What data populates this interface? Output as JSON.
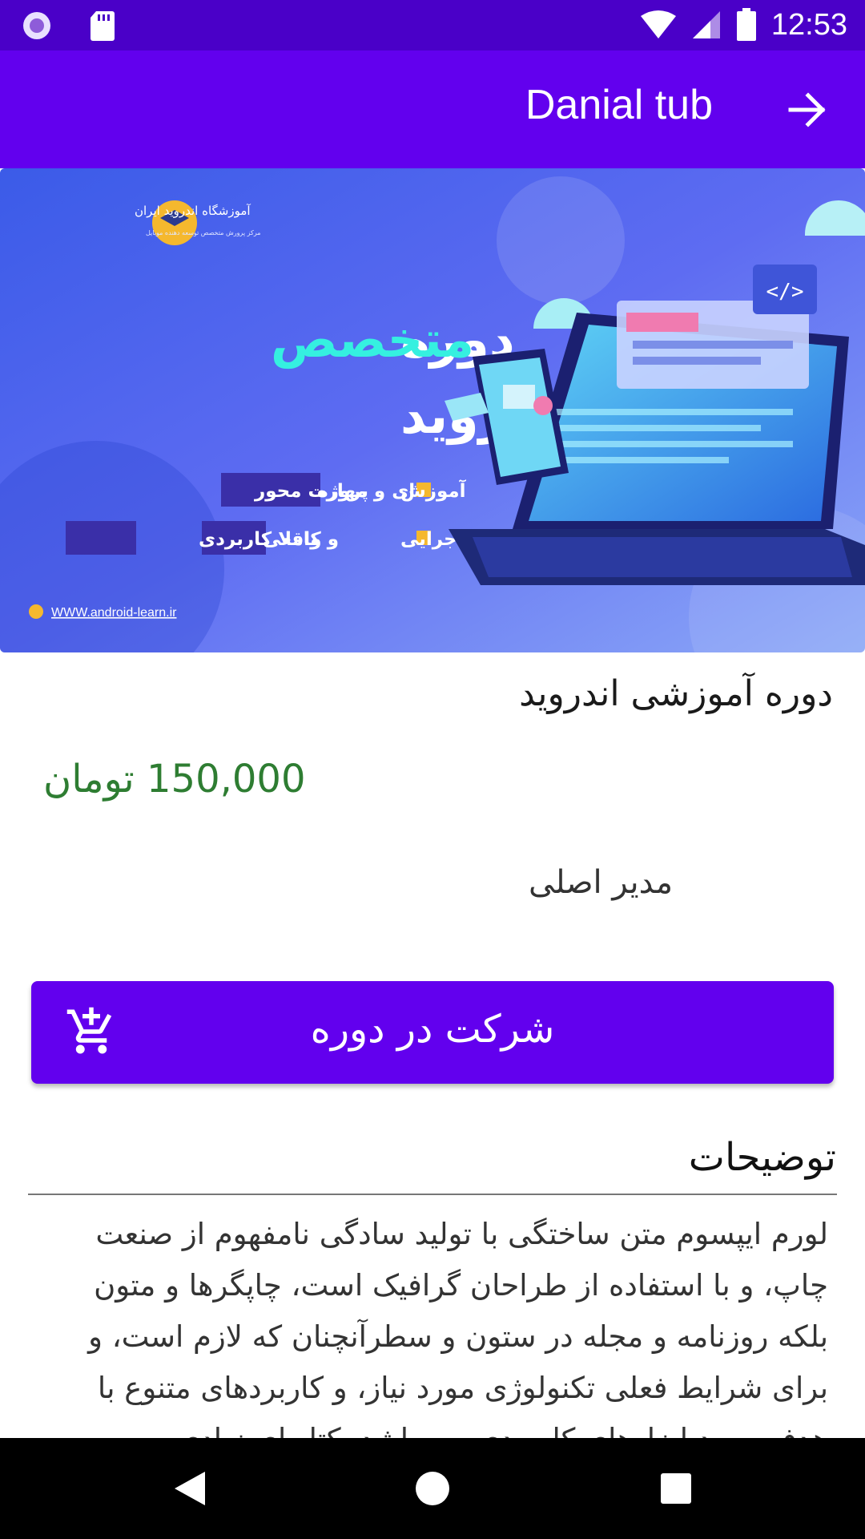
{
  "status_bar": {
    "time": "12:53",
    "icons": [
      "notification-circle-icon",
      "sd-card-icon",
      "wifi-icon",
      "signal-icon",
      "battery-icon"
    ]
  },
  "app_bar": {
    "title": "Danial tub",
    "back_icon": "arrow-right-icon"
  },
  "banner": {
    "brand_name": "آموزشگاه اندروید ایران",
    "brand_tagline": "مرکز پرورش متخصص توسعه دهنده موبایل",
    "headline_word1": "دوره",
    "headline_word2": "متخصص",
    "headline_line2": "اندروید",
    "bullet1_a": "آموزش",
    "bullet1_b": "پروژه",
    "bullet1_c": "ای و مهارت محور",
    "bullet2_a": "۶ پروژه اجرایی",
    "bullet2_b": "واقعی",
    "bullet2_c": "و کاملا کاربردی",
    "website": "WWW.android-learn.ir",
    "code_tag": "</>"
  },
  "course": {
    "title": "دوره آموزشی اندروید",
    "price": "150,000 تومان",
    "teacher": "مدیر اصلی"
  },
  "enroll": {
    "label": "شرکت در دوره",
    "icon": "add-shopping-cart-icon"
  },
  "description": {
    "heading": "توضیحات",
    "body": "لورم ایپسوم متن ساختگی با تولید سادگی نامفهوم از صنعت چاپ، و با استفاده از طراحان گرافیک است، چاپگرها و متون بلکه روزنامه و مجله در ستون و سطرآنچنان که لازم است، و برای شرایط فعلی تکنولوژی مورد نیاز، و کاربردهای متنوع با هدف بهبود ابزارهای کاربردی می باشد، کتابهای زیادی"
  },
  "nav_bar": {
    "buttons": [
      "back-triangle-icon",
      "home-circle-icon",
      "recents-square-icon"
    ]
  },
  "colors": {
    "status_bar": "#4A00C8",
    "primary": "#6200EE",
    "price": "#2E7D32"
  }
}
